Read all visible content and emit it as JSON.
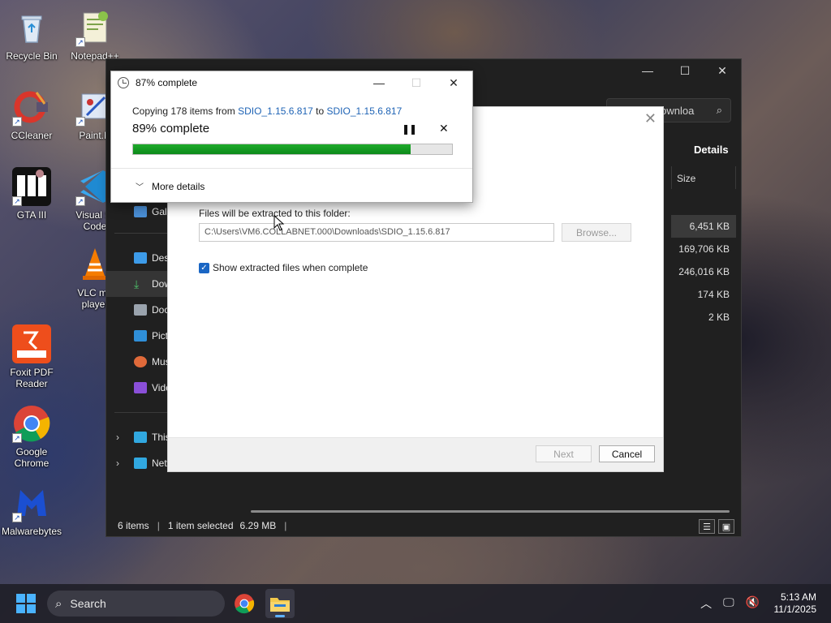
{
  "desktop": {
    "icons": [
      {
        "label": "Recycle Bin"
      },
      {
        "label": "Notepad++"
      },
      {
        "label": "CCleaner"
      },
      {
        "label": "Paint.N"
      },
      {
        "label": "GTA III"
      },
      {
        "label": "Visual St Code"
      },
      {
        "label": "VLC me player"
      },
      {
        "label": "Foxit PDF Reader"
      },
      {
        "label": "Google Chrome"
      },
      {
        "label": "Malwarebytes"
      }
    ]
  },
  "explorer": {
    "search_placeholder": "Search Downloa",
    "details_label": "Details",
    "size_header": "Size",
    "sizes": [
      "6,451 KB",
      "169,706 KB",
      "246,016 KB",
      "174 KB",
      "2 KB"
    ],
    "nav": [
      "Gall",
      "Desk",
      "Dow",
      "Doc",
      "Pict",
      "Mus",
      "Vide",
      "This",
      "Netw"
    ],
    "status": {
      "items": "6 items",
      "selected": "1 item selected",
      "size": "6.29 MB"
    }
  },
  "wizard": {
    "folder_label": "Files will be extracted to this folder:",
    "path_value": "C:\\Users\\VM6.COLLABNET.000\\Downloads\\SDIO_1.15.6.817",
    "browse_label": "Browse...",
    "checkbox_label": "Show extracted files when complete",
    "checkbox_checked": true,
    "next_label": "Next",
    "cancel_label": "Cancel"
  },
  "progress_dialog": {
    "title": "87% complete",
    "copy_prefix": "Copying 178 items from",
    "copy_source": "SDIO_1.15.6.817",
    "copy_to": "to",
    "copy_dest": "SDIO_1.15.6.817",
    "percent_text": "89% complete",
    "progress_fraction": 0.87,
    "more_details_label": "More details",
    "bar_color": "#16a024"
  },
  "taskbar": {
    "search_label": "Search",
    "time": "5:13 AM",
    "date": "11/1/2025",
    "accent": "#4ab3ff"
  }
}
